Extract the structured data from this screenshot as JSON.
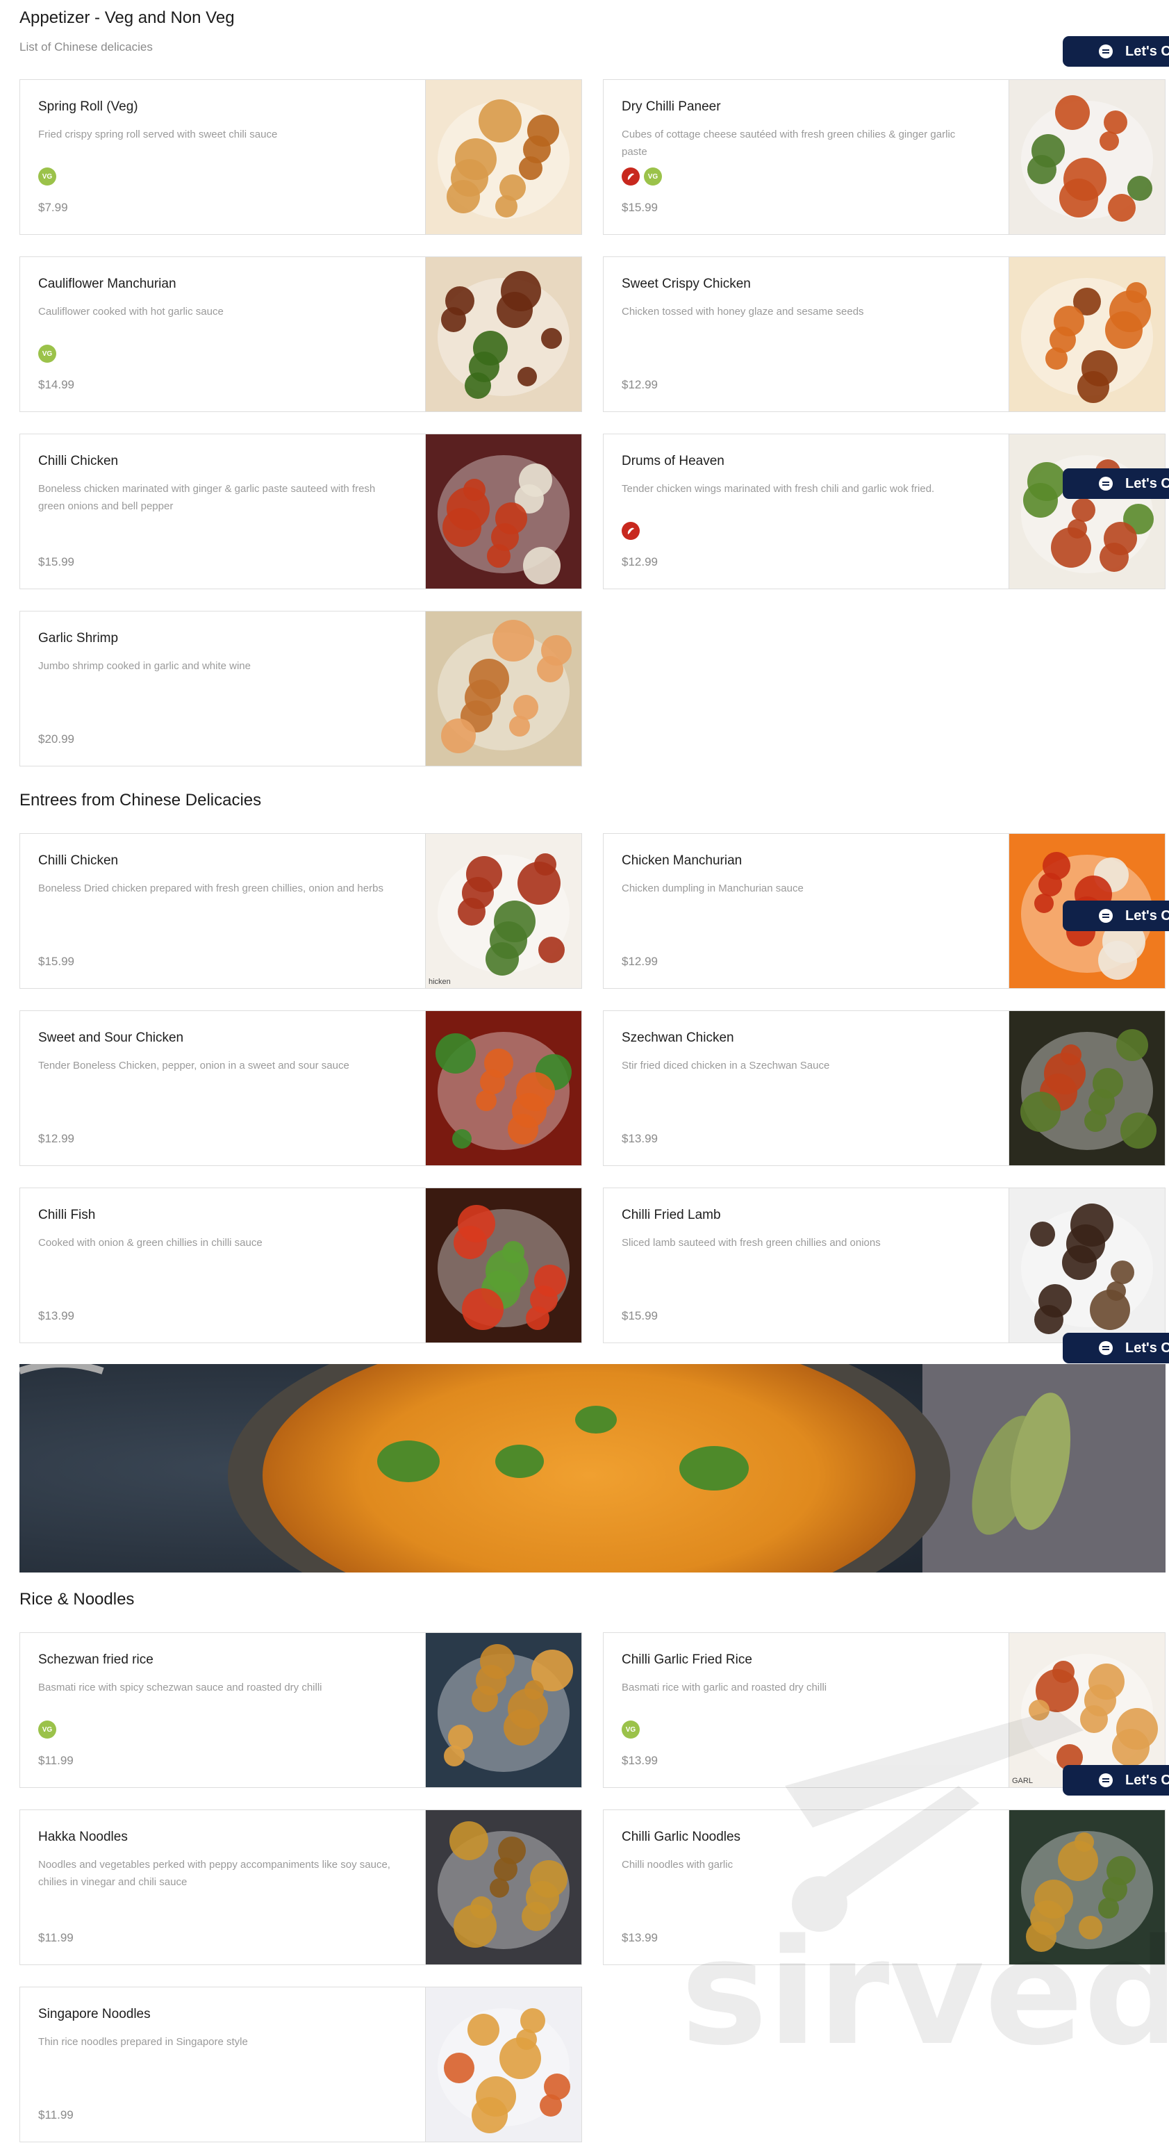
{
  "sections": [
    {
      "title": "Appetizer - Veg and Non Veg",
      "subtitle": "List of Chinese delicacies",
      "items": [
        {
          "name": "Spring Roll (Veg)",
          "description": "Fried crispy spring roll served with sweet chili sauce",
          "tags": [
            "VG"
          ],
          "price": "$7.99"
        },
        {
          "name": "Dry Chilli Paneer",
          "description": "Cubes of cottage cheese sautéed with fresh green chilies & ginger garlic paste",
          "tags": [
            "spicy",
            "VG"
          ],
          "price": "$15.99"
        },
        {
          "name": "Cauliflower Manchurian",
          "description": "Cauliflower cooked with hot garlic sauce",
          "tags": [
            "VG"
          ],
          "price": "$14.99"
        },
        {
          "name": "Sweet Crispy Chicken",
          "description": "Chicken tossed with honey glaze and sesame seeds",
          "tags": [],
          "price": "$12.99"
        },
        {
          "name": "Chilli Chicken",
          "description": "Boneless chicken marinated with ginger & garlic paste sauteed with fresh green onions and bell pepper",
          "tags": [],
          "price": "$15.99"
        },
        {
          "name": "Drums of Heaven",
          "description": "Tender chicken wings marinated with fresh chili and garlic wok fried.",
          "tags": [
            "spicy"
          ],
          "price": "$12.99"
        },
        {
          "name": "Garlic Shrimp",
          "description": "Jumbo shrimp cooked in garlic and white wine",
          "tags": [],
          "price": "$20.99"
        }
      ]
    },
    {
      "title": "Entrees from Chinese Delicacies",
      "items": [
        {
          "name": "Chilli Chicken",
          "description": "Boneless Dried chicken prepared with fresh green chillies, onion and herbs",
          "tags": [],
          "price": "$15.99",
          "photo_caption": "hicken"
        },
        {
          "name": "Chicken Manchurian",
          "description": "Chicken dumpling in Manchurian sauce",
          "tags": [],
          "price": "$12.99"
        },
        {
          "name": "Sweet and Sour Chicken",
          "description": "Tender Boneless Chicken, pepper, onion in a sweet and sour sauce",
          "tags": [],
          "price": "$12.99"
        },
        {
          "name": "Szechwan Chicken",
          "description": "Stir fried diced chicken in a Szechwan Sauce",
          "tags": [],
          "price": "$13.99"
        },
        {
          "name": "Chilli Fish",
          "description": "Cooked with onion & green chillies in chilli sauce",
          "tags": [],
          "price": "$13.99"
        },
        {
          "name": "Chilli Fried Lamb",
          "description": "Sliced lamb sauteed with fresh green chillies and onions",
          "tags": [],
          "price": "$15.99"
        }
      ]
    },
    {
      "title": "Rice & Noodles",
      "items": [
        {
          "name": "Schezwan fried rice",
          "description": "Basmati rice with spicy schezwan sauce and roasted dry chilli",
          "tags": [
            "VG"
          ],
          "price": "$11.99"
        },
        {
          "name": "Chilli Garlic Fried Rice",
          "description": "Basmati rice with garlic and roasted dry chilli",
          "tags": [
            "VG"
          ],
          "price": "$13.99",
          "photo_caption": "GARL"
        },
        {
          "name": "Hakka Noodles",
          "description": "Noodles and vegetables perked with peppy accompaniments like soy sauce, chilies in vinegar and chili sauce",
          "tags": [],
          "price": "$11.99"
        },
        {
          "name": "Chilli Garlic Noodles",
          "description": "Chilli noodles with garlic",
          "tags": [],
          "price": "$13.99"
        },
        {
          "name": "Singapore Noodles",
          "description": "Thin rice noodles prepared in Singapore style",
          "tags": [],
          "price": "$11.99"
        }
      ]
    }
  ],
  "chat_button": {
    "label": "Let's C",
    "icon": "chat-bubble-icon"
  },
  "watermark": {
    "text": "sirved"
  },
  "colors": {
    "vg": "#9bc24a",
    "spicy": "#c8281e",
    "chat": "#0f2149"
  }
}
